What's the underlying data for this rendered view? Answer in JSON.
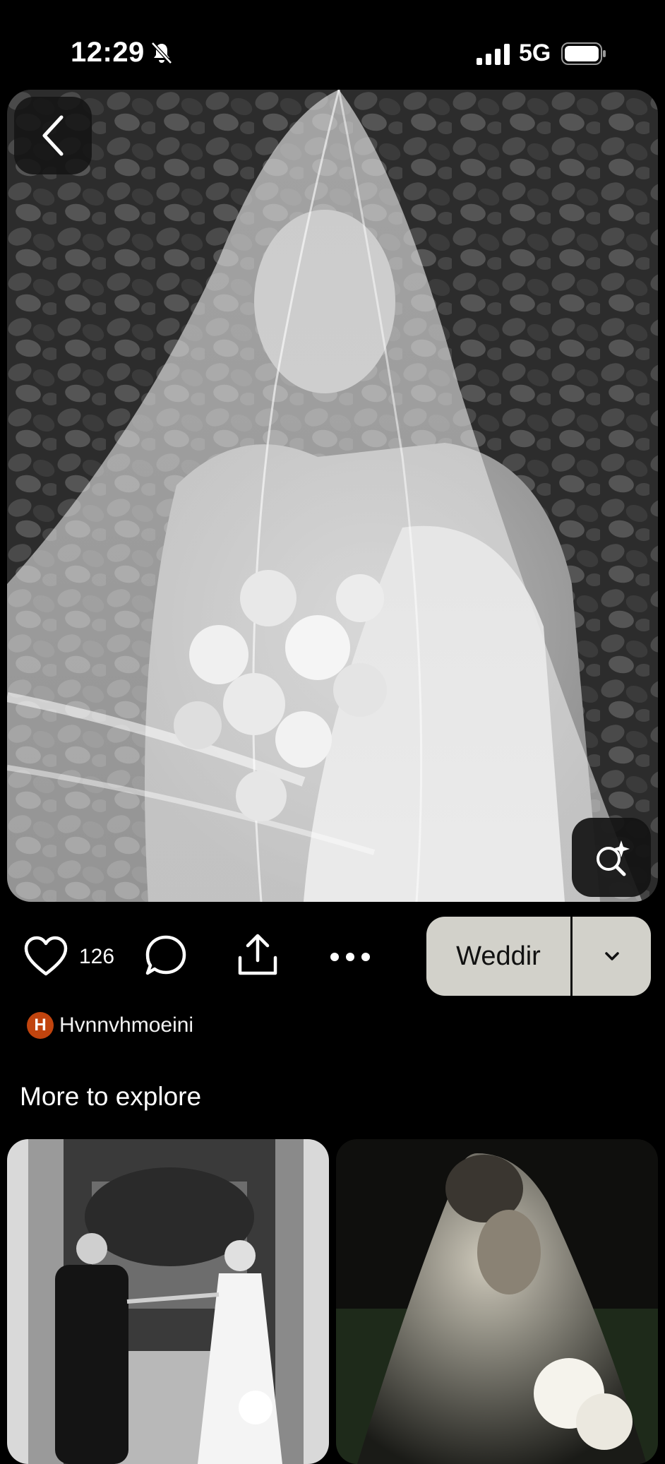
{
  "status_bar": {
    "time": "12:29",
    "network": "5G"
  },
  "pin": {
    "like_count": "126",
    "board_button_label": "Weddir",
    "author": {
      "initial": "H",
      "name": "Hvnnvhmoeini"
    }
  },
  "section": {
    "title": "More to explore"
  },
  "icons": {
    "back": "chevron-left-icon",
    "visual_search": "visual-search-icon",
    "like": "heart-icon",
    "comment": "comment-icon",
    "share": "share-icon",
    "more": "more-icon",
    "board_dropdown": "chevron-down-icon"
  },
  "colors": {
    "background": "#000000",
    "board_button": "#d2d1ca",
    "avatar": "#c1440e"
  }
}
